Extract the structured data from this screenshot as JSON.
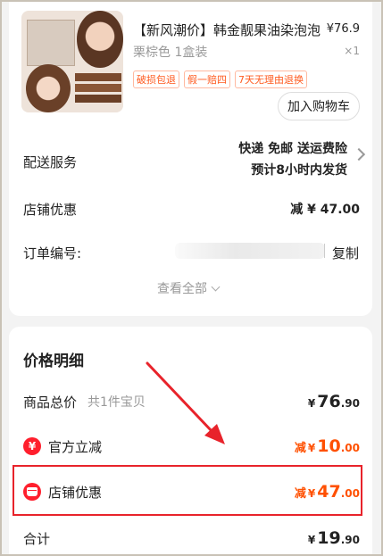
{
  "order_card": {
    "product": {
      "title": "【新风潮价】韩金靓果油染泡泡",
      "price": "¥76.9",
      "variant": "栗棕色 1盒装",
      "quantity": "×1",
      "tags": [
        "破损包退",
        "假一赔四",
        "7天无理由退换"
      ],
      "add_to_cart": "加入购物车"
    },
    "shipping": {
      "label": "配送服务",
      "line1": "快递 免邮 送运费险",
      "line2": "预计8小时内发货"
    },
    "store_discount": {
      "label": "店铺优惠",
      "value": "减 ¥ 47.00"
    },
    "order_number": {
      "label": "订单编号:",
      "copy": "复制"
    },
    "view_all": "查看全部"
  },
  "price_detail": {
    "title": "价格明细",
    "total": {
      "label": "商品总价",
      "sub": "共1件宝贝",
      "currency": "¥",
      "int": "76",
      "dec": ".90"
    },
    "official": {
      "icon": "¥",
      "label": "官方立减",
      "prefix": "减",
      "currency": "¥",
      "int": "10",
      "dec": ".00"
    },
    "store": {
      "label": "店铺优惠",
      "prefix": "减",
      "currency": "¥",
      "int": "47",
      "dec": ".00"
    },
    "sum": {
      "label": "合计",
      "currency": "¥",
      "int": "19",
      "dec": ".90"
    }
  },
  "colors": {
    "accent": "#ff5000",
    "highlight": "#e8232b",
    "icon_red": "#ff1f2d"
  }
}
